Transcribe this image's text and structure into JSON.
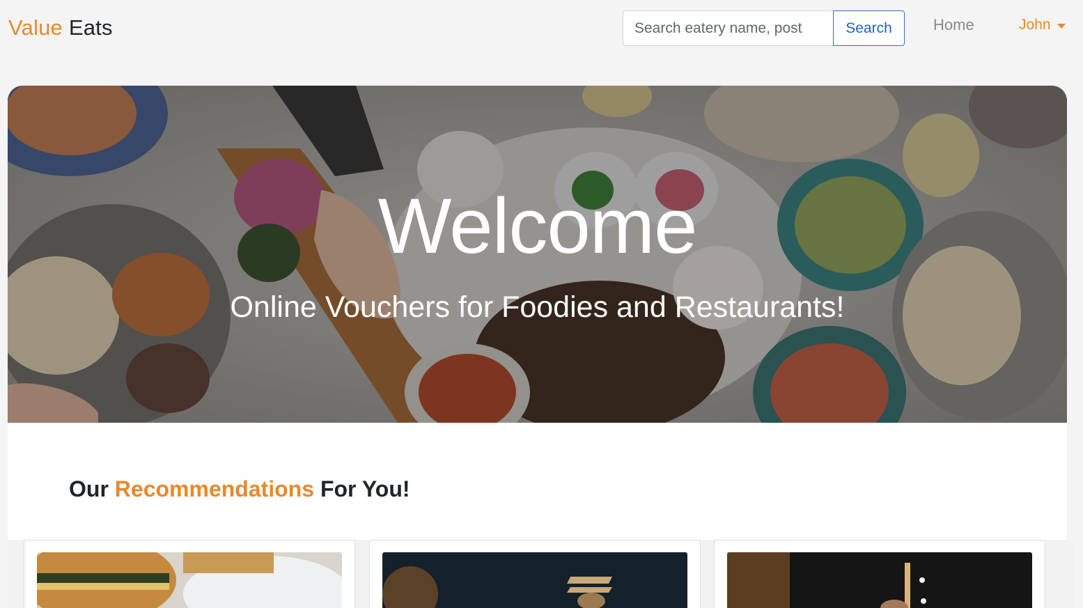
{
  "brand": {
    "part1": "Value",
    "part2": "Eats",
    "accent_color": "#e8892b"
  },
  "search": {
    "placeholder": "Search eatery name, post",
    "button_label": "Search"
  },
  "nav": {
    "home_label": "Home",
    "user_label": "John"
  },
  "hero": {
    "title": "Welcome",
    "subtitle": "Online Vouchers for Foodies and Restaurants!"
  },
  "recommendations": {
    "heading_prefix": "Our",
    "heading_accent": "Recommendations",
    "heading_suffix": "For You!"
  },
  "cards": [
    {
      "image": "burger-photo"
    },
    {
      "image": "chopsticks-photo"
    },
    {
      "image": "chef-photo"
    }
  ],
  "colors": {
    "accent": "#e8892b",
    "link_blue": "#1f63c9",
    "page_bg": "#f4f4f4"
  }
}
